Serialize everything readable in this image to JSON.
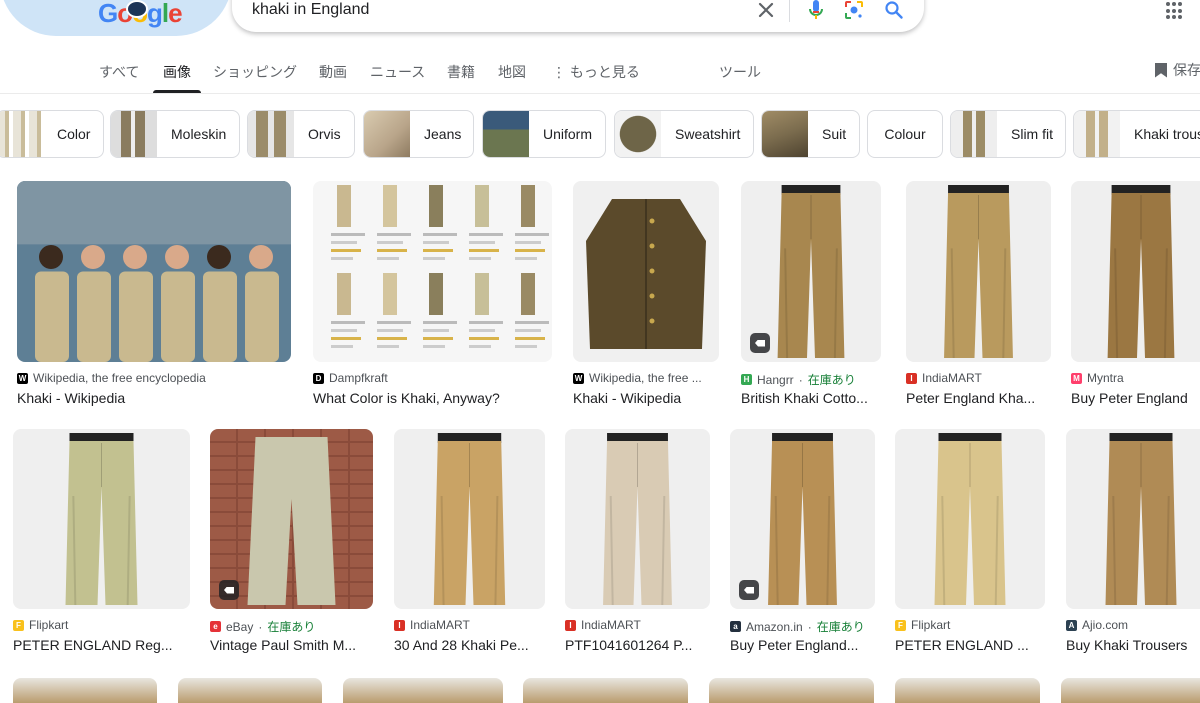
{
  "header": {
    "logo_letters": [
      "G",
      "o",
      "o",
      "g",
      "l",
      "e"
    ],
    "search_query": "khaki in England",
    "icons": [
      "close-icon",
      "mic-icon",
      "lens-icon",
      "search-icon",
      "apps-icon"
    ]
  },
  "tabs": [
    {
      "label": "すべて",
      "active": false
    },
    {
      "label": "画像",
      "active": true
    },
    {
      "label": "ショッピング",
      "active": false
    },
    {
      "label": "動画",
      "active": false
    },
    {
      "label": "ニュース",
      "active": false
    },
    {
      "label": "書籍",
      "active": false
    },
    {
      "label": "地図",
      "active": false
    },
    {
      "label": "⋮ もっと見る",
      "active": false
    },
    {
      "label": "ツール",
      "active": false
    }
  ],
  "save_label": "保存",
  "chips": [
    {
      "label": "Color",
      "color": "#e8e4d8"
    },
    {
      "label": "Moleskin",
      "color": "#8a7c5f"
    },
    {
      "label": "Orvis",
      "color": "#9b8c6a"
    },
    {
      "label": "Jeans",
      "color": "#b9a58a"
    },
    {
      "label": "Uniform",
      "color": "#6b7650"
    },
    {
      "label": "Sweatshirt",
      "color": "#6e6548"
    },
    {
      "label": "Suit",
      "color": "#7b6c4e"
    },
    {
      "label": "Colour",
      "color": ""
    },
    {
      "label": "Slim fit",
      "color": "#9c8c66"
    },
    {
      "label": "Khaki trousers",
      "color": "#c2b08a"
    }
  ],
  "results_row1": [
    {
      "source": "Wikipedia, the free encyclopedia",
      "title": "Khaki - Wikipedia",
      "favicon": "W",
      "fav_color": "#000000",
      "in_stock": "",
      "tag": false,
      "color": "#c9b98f"
    },
    {
      "source": "Dampfkraft",
      "title": "What Color is Khaki, Anyway?",
      "favicon": "D",
      "fav_color": "#000000",
      "in_stock": "",
      "tag": false,
      "color": "#f4f4f4"
    },
    {
      "source": "Wikipedia, the free ...",
      "title": "Khaki - Wikipedia",
      "favicon": "W",
      "fav_color": "#000000",
      "in_stock": "",
      "tag": false,
      "color": "#5b4a2b"
    },
    {
      "source": "Hangrr",
      "title": "British Khaki Cotto...",
      "favicon": "H",
      "fav_color": "#34a853",
      "in_stock": "在庫あり",
      "tag": true,
      "color": "#a8874f"
    },
    {
      "source": "IndiaMART",
      "title": "Peter England Kha...",
      "favicon": "I",
      "fav_color": "#d93025",
      "in_stock": "",
      "tag": false,
      "color": "#b99a5e"
    },
    {
      "source": "Myntra",
      "title": "Buy Peter England",
      "favicon": "M",
      "fav_color": "#ff3f6c",
      "in_stock": "",
      "tag": false,
      "color": "#9b7742"
    }
  ],
  "results_row2": [
    {
      "source": "Flipkart",
      "title": "PETER ENGLAND Reg...",
      "favicon": "F",
      "fav_color": "#f9c11c",
      "in_stock": "",
      "tag": false,
      "color": "#c2c190"
    },
    {
      "source": "eBay",
      "title": "Vintage Paul Smith M...",
      "favicon": "e",
      "fav_color": "#e53238",
      "in_stock": "在庫あり",
      "tag": true,
      "color": "#c9c7ad"
    },
    {
      "source": "IndiaMART",
      "title": "30 And 28 Khaki Pe...",
      "favicon": "I",
      "fav_color": "#d93025",
      "in_stock": "",
      "tag": false,
      "color": "#c9a365"
    },
    {
      "source": "IndiaMART",
      "title": "PTF1041601264 P...",
      "favicon": "I",
      "fav_color": "#d93025",
      "in_stock": "",
      "tag": false,
      "color": "#d9cbb4"
    },
    {
      "source": "Amazon.in",
      "title": "Buy Peter England...",
      "favicon": "a",
      "fav_color": "#232f3e",
      "in_stock": "在庫あり",
      "tag": true,
      "color": "#b89055"
    },
    {
      "source": "Flipkart",
      "title": "PETER ENGLAND ...",
      "favicon": "F",
      "fav_color": "#f9c11c",
      "in_stock": "",
      "tag": false,
      "color": "#d9c48c"
    },
    {
      "source": "Ajio.com",
      "title": "Buy Khaki Trousers",
      "favicon": "A",
      "fav_color": "#2c4152",
      "in_stock": "",
      "tag": false,
      "color": "#b08b55"
    }
  ]
}
